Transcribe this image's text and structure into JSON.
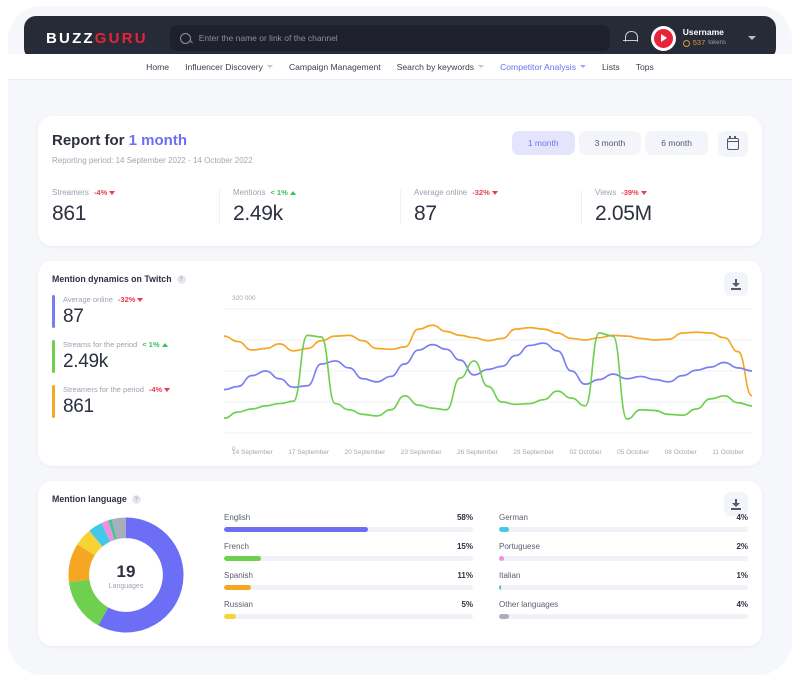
{
  "header": {
    "logo_primary": "BUZZ",
    "logo_accent": "GURU",
    "search_placeholder": "Enter the name or link of the channel",
    "search_value": "",
    "username": "Username",
    "tokens_count": "537",
    "tokens_label": "tokens"
  },
  "nav": {
    "items": [
      {
        "label": "Home",
        "caret": false,
        "active": false
      },
      {
        "label": "Influencer Discovery",
        "caret": true,
        "active": false
      },
      {
        "label": "Campaign Management",
        "caret": false,
        "active": false
      },
      {
        "label": "Search by keywords",
        "caret": true,
        "active": false
      },
      {
        "label": "Competitor Analysis",
        "caret": true,
        "active": true
      },
      {
        "label": "Lists",
        "caret": false,
        "active": false
      },
      {
        "label": "Tops",
        "caret": false,
        "active": false
      }
    ]
  },
  "report": {
    "title_prefix": "Report for ",
    "title_highlight": "1 month",
    "subtitle": "Reporting period: 14 September 2022 - 14 October 2022",
    "periods": [
      {
        "label": "1 month",
        "selected": true
      },
      {
        "label": "3 month",
        "selected": false
      },
      {
        "label": "6 month",
        "selected": false
      }
    ],
    "calendar_icon": "calendar-icon",
    "kpis": [
      {
        "label": "Streamers",
        "delta": "-4%",
        "direction": "down",
        "value": "861"
      },
      {
        "label": "Mentions",
        "delta": "< 1%",
        "direction": "up",
        "value": "2.49k"
      },
      {
        "label": "Average online",
        "delta": "-32%",
        "direction": "down",
        "value": "87"
      },
      {
        "label": "Views",
        "delta": "-39%",
        "direction": "down",
        "value": "2.05M"
      }
    ]
  },
  "dynamics": {
    "title": "Mention dynamics on Twitch",
    "help_icon": "question-mark-icon",
    "download_icon": "download-icon",
    "stats": [
      {
        "label": "Average online",
        "delta": "-32%",
        "direction": "down",
        "value": "87",
        "color": "#7b7ef0"
      },
      {
        "label": "Streams for the period",
        "delta": "< 1%",
        "direction": "up",
        "value": "2.49k",
        "color": "#6fcf4f"
      },
      {
        "label": "Streamers for the period",
        "delta": "-4%",
        "direction": "down",
        "value": "861",
        "color": "#f5a623"
      }
    ]
  },
  "language": {
    "title": "Mention language",
    "help_icon": "question-mark-icon",
    "download_icon": "download-icon",
    "donut_value": "19",
    "donut_label": "Languages",
    "left_column": [
      {
        "name": "English",
        "pct": "58%",
        "value": 58,
        "color": "#6c6ff5"
      },
      {
        "name": "French",
        "pct": "15%",
        "value": 15,
        "color": "#6fcf4f"
      },
      {
        "name": "Spanish",
        "pct": "11%",
        "value": 11,
        "color": "#f5a623"
      },
      {
        "name": "Russian",
        "pct": "5%",
        "value": 5,
        "color": "#f8d336"
      }
    ],
    "right_column": [
      {
        "name": "German",
        "pct": "4%",
        "value": 4,
        "color": "#43c9e8"
      },
      {
        "name": "Portuguese",
        "pct": "2%",
        "value": 2,
        "color": "#ef8fe0"
      },
      {
        "name": "Italian",
        "pct": "1%",
        "value": 1,
        "color": "#3fc98f"
      },
      {
        "name": "Other languages",
        "pct": "4%",
        "value": 4,
        "color": "#a9aebd"
      }
    ]
  },
  "chart_data": [
    {
      "type": "line",
      "title": "Mention dynamics on Twitch",
      "xlabel": "",
      "ylabel": "",
      "ylim": [
        0,
        320000
      ],
      "ytick_labels": [
        "320 000",
        "0"
      ],
      "grid": true,
      "legend_position": "left",
      "categories": [
        "14 September",
        "17 September",
        "20 September",
        "23 September",
        "26 September",
        "29 September",
        "02 October",
        "05 October",
        "08 October",
        "11 October"
      ],
      "series": [
        {
          "name": "Streamers for the period",
          "color": "#f5a623",
          "values": [
            250000,
            236000,
            214000,
            218000,
            230000,
            212000,
            218000,
            238000,
            250000,
            252000,
            238000,
            218000,
            216000,
            222000,
            268000,
            278000,
            262000,
            252000,
            246000,
            238000,
            244000,
            268000,
            272000,
            268000,
            258000,
            244000,
            240000,
            246000,
            252000,
            250000,
            244000,
            240000,
            242000,
            258000,
            260000,
            258000,
            246000,
            210000,
            96000
          ]
        },
        {
          "name": "Average online",
          "color": "#7b7ef0",
          "values": [
            112000,
            120000,
            148000,
            160000,
            140000,
            118000,
            122000,
            178000,
            186000,
            168000,
            140000,
            132000,
            146000,
            178000,
            214000,
            228000,
            216000,
            188000,
            150000,
            164000,
            172000,
            200000,
            226000,
            232000,
            212000,
            160000,
            126000,
            138000,
            152000,
            140000,
            146000,
            138000,
            132000,
            148000,
            162000,
            170000,
            182000,
            168000,
            160000
          ]
        },
        {
          "name": "Streams for the period",
          "color": "#6fcf4f",
          "values": [
            38000,
            54000,
            62000,
            70000,
            76000,
            82000,
            252000,
            248000,
            76000,
            60000,
            48000,
            44000,
            60000,
            96000,
            72000,
            64000,
            60000,
            142000,
            186000,
            120000,
            80000,
            74000,
            76000,
            86000,
            108000,
            90000,
            70000,
            258000,
            250000,
            36000,
            60000,
            58000,
            48000,
            46000,
            62000,
            88000,
            96000,
            78000,
            70000
          ]
        }
      ]
    },
    {
      "type": "pie",
      "title": "Mention language",
      "center_value": "19",
      "center_label": "Languages",
      "labels": [
        "English",
        "French",
        "Spanish",
        "Russian",
        "German",
        "Portuguese",
        "Italian",
        "Other languages"
      ],
      "values": [
        58,
        15,
        11,
        5,
        4,
        2,
        1,
        4
      ],
      "colors": [
        "#6c6ff5",
        "#6fcf4f",
        "#f5a623",
        "#f8d336",
        "#43c9e8",
        "#ef8fe0",
        "#3fc98f",
        "#a9aebd"
      ]
    }
  ]
}
